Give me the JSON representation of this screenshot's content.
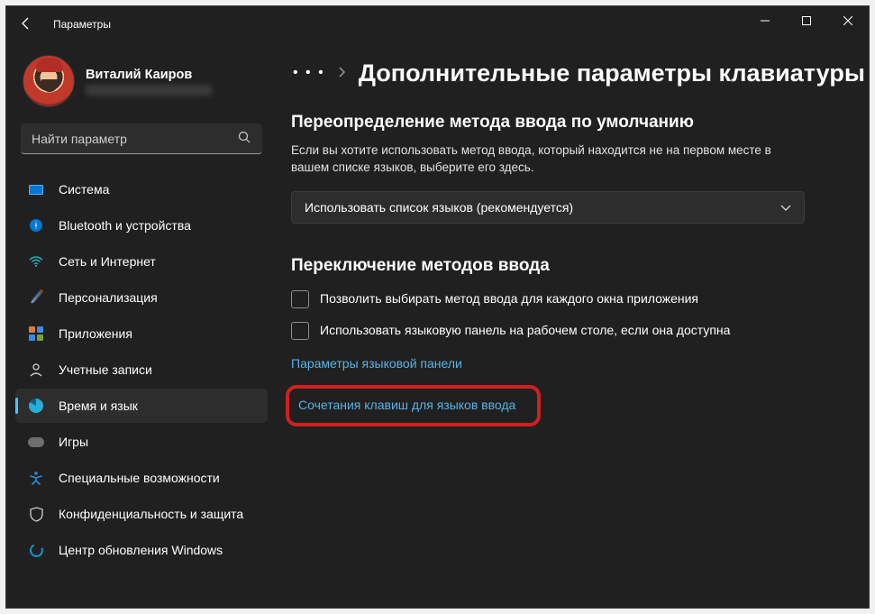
{
  "window": {
    "title": "Параметры"
  },
  "profile": {
    "name": "Виталий Каиров"
  },
  "search": {
    "placeholder": "Найти параметр"
  },
  "sidebar": {
    "items": [
      {
        "label": "Система",
        "icon": "system-icon"
      },
      {
        "label": "Bluetooth и устройства",
        "icon": "bluetooth-icon"
      },
      {
        "label": "Сеть и Интернет",
        "icon": "network-icon"
      },
      {
        "label": "Персонализация",
        "icon": "personalization-icon"
      },
      {
        "label": "Приложения",
        "icon": "apps-icon"
      },
      {
        "label": "Учетные записи",
        "icon": "accounts-icon"
      },
      {
        "label": "Время и язык",
        "icon": "time-language-icon"
      },
      {
        "label": "Игры",
        "icon": "gaming-icon"
      },
      {
        "label": "Специальные возможности",
        "icon": "accessibility-icon"
      },
      {
        "label": "Конфиденциальность и защита",
        "icon": "privacy-icon"
      },
      {
        "label": "Центр обновления Windows",
        "icon": "windows-update-icon"
      }
    ],
    "activeIndex": 6
  },
  "breadcrumb": {
    "dots": "• • •",
    "title": "Дополнительные параметры клавиатуры"
  },
  "section1": {
    "title": "Переопределение метода ввода по умолчанию",
    "desc": "Если вы хотите использовать метод ввода, который находится не на первом месте в вашем списке языков, выберите его здесь.",
    "dropdown": "Использовать список языков (рекомендуется)"
  },
  "section2": {
    "title": "Переключение методов ввода",
    "check1": "Позволить выбирать метод ввода для каждого окна приложения",
    "check2": "Использовать языковую панель на рабочем столе, если она доступна"
  },
  "links": {
    "langbar": "Параметры языковой панели",
    "hotkeys": "Сочетания клавиш для языков ввода"
  }
}
